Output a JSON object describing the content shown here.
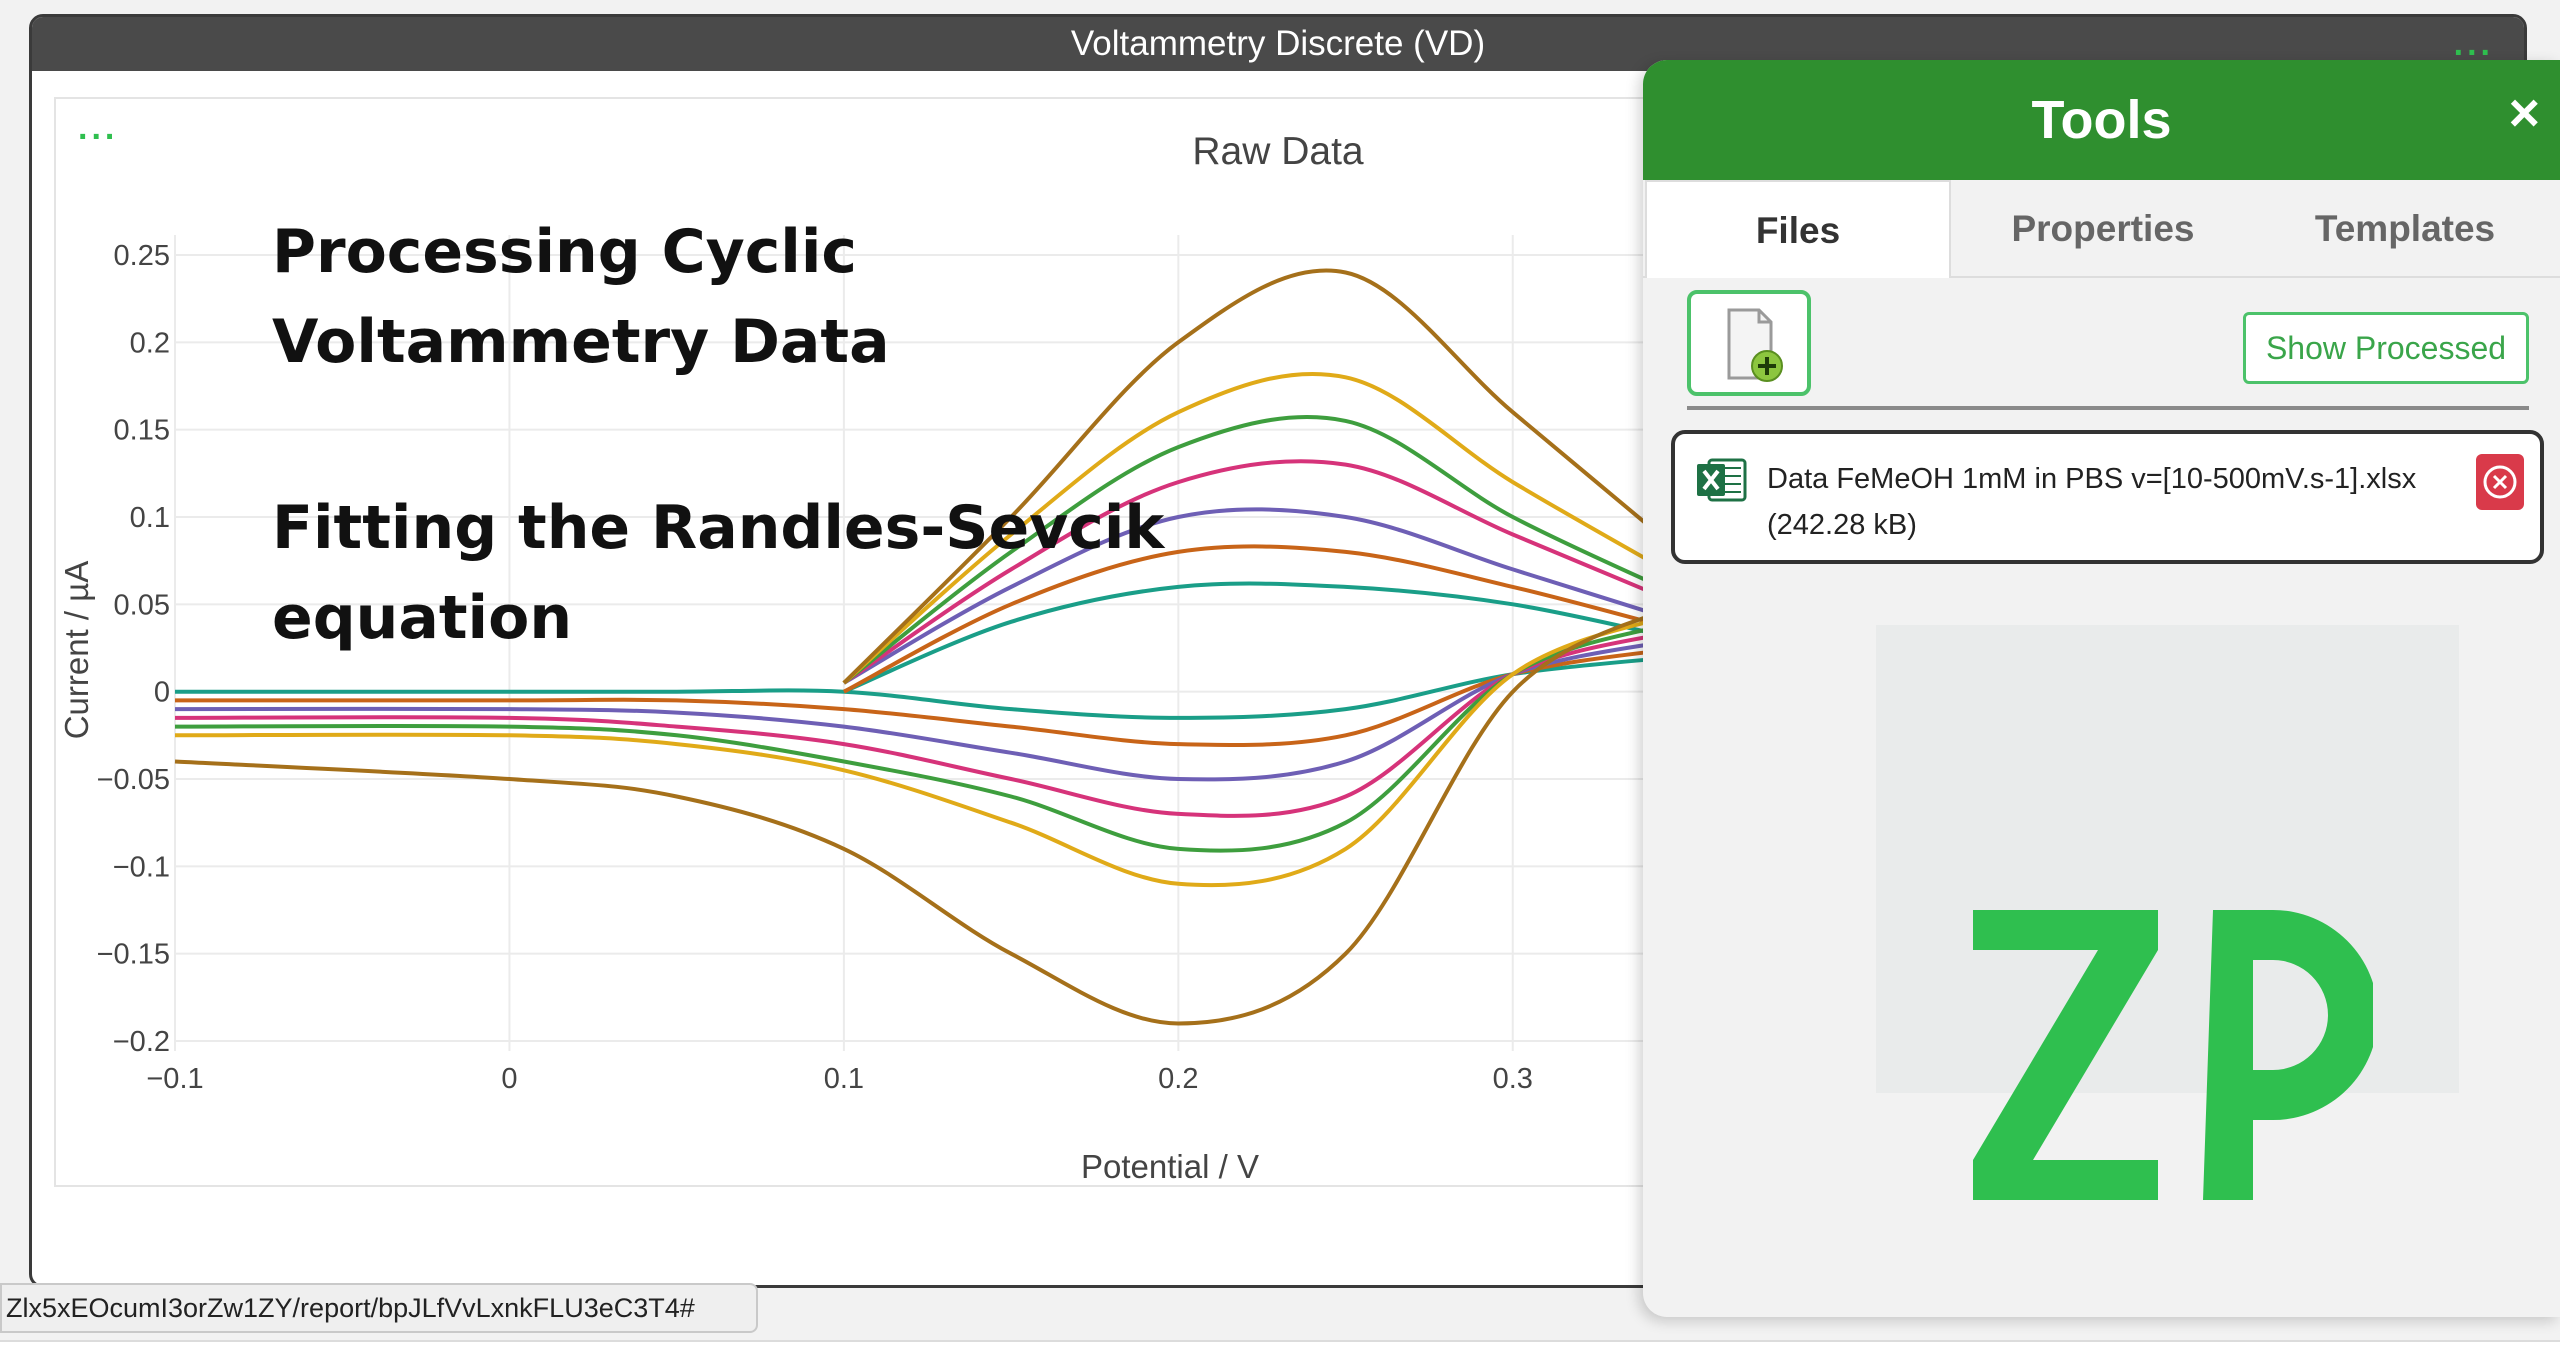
{
  "window": {
    "title": "Voltammetry Discrete (VD)",
    "menu_dots": "...",
    "plot_menu_dots": "..."
  },
  "overlay": {
    "line1": "Processing Cyclic",
    "line2": "Voltammetry Data",
    "line3": "Fitting the Randles-Sevcik",
    "line4": "equation"
  },
  "chart_data": {
    "type": "line",
    "title": "Raw Data",
    "xlabel": "Potential / V",
    "ylabel": "Current / µA",
    "xlim": [
      -0.1,
      0.35
    ],
    "ylim": [
      -0.2,
      0.25
    ],
    "x_ticks": [
      "−0.1",
      "0",
      "0.1",
      "0.2",
      "0.3"
    ],
    "x_tick_values": [
      -0.1,
      0,
      0.1,
      0.2,
      0.3
    ],
    "y_ticks": [
      "0.25",
      "0.2",
      "0.15",
      "0.1",
      "0.05",
      "0",
      "−0.05",
      "−0.1",
      "−0.15",
      "−0.2"
    ],
    "y_tick_values": [
      0.25,
      0.2,
      0.15,
      0.1,
      0.05,
      0,
      -0.05,
      -0.1,
      -0.15,
      -0.2
    ],
    "grid": true,
    "series": [
      {
        "color": "#1a9e88",
        "forward": [
          [
            -0.1,
            0.0
          ],
          [
            0.0,
            0.0
          ],
          [
            0.05,
            0.0
          ],
          [
            0.1,
            0.0
          ],
          [
            0.15,
            -0.01
          ],
          [
            0.2,
            -0.015
          ],
          [
            0.25,
            -0.01
          ],
          [
            0.3,
            0.01
          ],
          [
            0.35,
            0.02
          ]
        ],
        "reverse": [
          [
            0.35,
            0.03
          ],
          [
            0.3,
            0.05
          ],
          [
            0.25,
            0.06
          ],
          [
            0.2,
            0.06
          ],
          [
            0.15,
            0.04
          ],
          [
            0.1,
            0.0
          ]
        ]
      },
      {
        "color": "#c86418",
        "forward": [
          [
            -0.1,
            -0.005
          ],
          [
            0.0,
            -0.005
          ],
          [
            0.05,
            -0.005
          ],
          [
            0.1,
            -0.01
          ],
          [
            0.15,
            -0.02
          ],
          [
            0.2,
            -0.03
          ],
          [
            0.25,
            -0.025
          ],
          [
            0.3,
            0.01
          ],
          [
            0.35,
            0.025
          ]
        ],
        "reverse": [
          [
            0.35,
            0.035
          ],
          [
            0.3,
            0.06
          ],
          [
            0.25,
            0.08
          ],
          [
            0.2,
            0.08
          ],
          [
            0.15,
            0.05
          ],
          [
            0.1,
            0.0
          ]
        ]
      },
      {
        "color": "#6e5fb5",
        "forward": [
          [
            -0.1,
            -0.01
          ],
          [
            0.0,
            -0.01
          ],
          [
            0.05,
            -0.012
          ],
          [
            0.1,
            -0.02
          ],
          [
            0.15,
            -0.035
          ],
          [
            0.2,
            -0.05
          ],
          [
            0.25,
            -0.04
          ],
          [
            0.3,
            0.01
          ],
          [
            0.35,
            0.03
          ]
        ],
        "reverse": [
          [
            0.35,
            0.04
          ],
          [
            0.3,
            0.07
          ],
          [
            0.25,
            0.1
          ],
          [
            0.2,
            0.1
          ],
          [
            0.15,
            0.06
          ],
          [
            0.1,
            0.005
          ]
        ]
      },
      {
        "color": "#d6337a",
        "forward": [
          [
            -0.1,
            -0.015
          ],
          [
            0.0,
            -0.015
          ],
          [
            0.05,
            -0.02
          ],
          [
            0.1,
            -0.03
          ],
          [
            0.15,
            -0.05
          ],
          [
            0.2,
            -0.07
          ],
          [
            0.25,
            -0.06
          ],
          [
            0.3,
            0.01
          ],
          [
            0.35,
            0.035
          ]
        ],
        "reverse": [
          [
            0.35,
            0.05
          ],
          [
            0.3,
            0.09
          ],
          [
            0.25,
            0.13
          ],
          [
            0.2,
            0.12
          ],
          [
            0.15,
            0.07
          ],
          [
            0.1,
            0.005
          ]
        ]
      },
      {
        "color": "#3e9e3e",
        "forward": [
          [
            -0.1,
            -0.02
          ],
          [
            0.0,
            -0.02
          ],
          [
            0.05,
            -0.025
          ],
          [
            0.1,
            -0.04
          ],
          [
            0.15,
            -0.06
          ],
          [
            0.2,
            -0.09
          ],
          [
            0.25,
            -0.075
          ],
          [
            0.3,
            0.01
          ],
          [
            0.35,
            0.04
          ]
        ],
        "reverse": [
          [
            0.35,
            0.055
          ],
          [
            0.3,
            0.1
          ],
          [
            0.25,
            0.155
          ],
          [
            0.2,
            0.14
          ],
          [
            0.15,
            0.08
          ],
          [
            0.1,
            0.005
          ]
        ]
      },
      {
        "color": "#e0aa18",
        "forward": [
          [
            -0.1,
            -0.025
          ],
          [
            0.0,
            -0.025
          ],
          [
            0.05,
            -0.03
          ],
          [
            0.1,
            -0.045
          ],
          [
            0.15,
            -0.075
          ],
          [
            0.2,
            -0.11
          ],
          [
            0.25,
            -0.09
          ],
          [
            0.3,
            0.01
          ],
          [
            0.35,
            0.045
          ]
        ],
        "reverse": [
          [
            0.35,
            0.065
          ],
          [
            0.3,
            0.12
          ],
          [
            0.25,
            0.18
          ],
          [
            0.2,
            0.16
          ],
          [
            0.15,
            0.09
          ],
          [
            0.1,
            0.005
          ]
        ]
      },
      {
        "color": "#a5701a",
        "forward": [
          [
            -0.1,
            -0.04
          ],
          [
            0.0,
            -0.05
          ],
          [
            0.05,
            -0.06
          ],
          [
            0.1,
            -0.09
          ],
          [
            0.15,
            -0.15
          ],
          [
            0.2,
            -0.19
          ],
          [
            0.25,
            -0.15
          ],
          [
            0.3,
            0.0
          ],
          [
            0.35,
            0.05
          ]
        ],
        "reverse": [
          [
            0.35,
            0.08
          ],
          [
            0.3,
            0.16
          ],
          [
            0.25,
            0.24
          ],
          [
            0.2,
            0.2
          ],
          [
            0.15,
            0.1
          ],
          [
            0.1,
            0.005
          ]
        ]
      }
    ]
  },
  "tools": {
    "title": "Tools",
    "close": "×",
    "tabs": [
      "Files",
      "Properties",
      "Templates"
    ],
    "show_processed": "Show Processed",
    "file": {
      "name": "Data FeMeOH 1mM in PBS v=[10-500mV.s-1].xlsx",
      "size": "(242.28 kB)",
      "icon": "excel-icon"
    },
    "logo_text": "ZP",
    "brand_green": "#2fbf4f"
  },
  "url": "Zlx5xEOcumI3orZw1ZY/report/bpJLfVvLxnkFLU3eC3T4#"
}
